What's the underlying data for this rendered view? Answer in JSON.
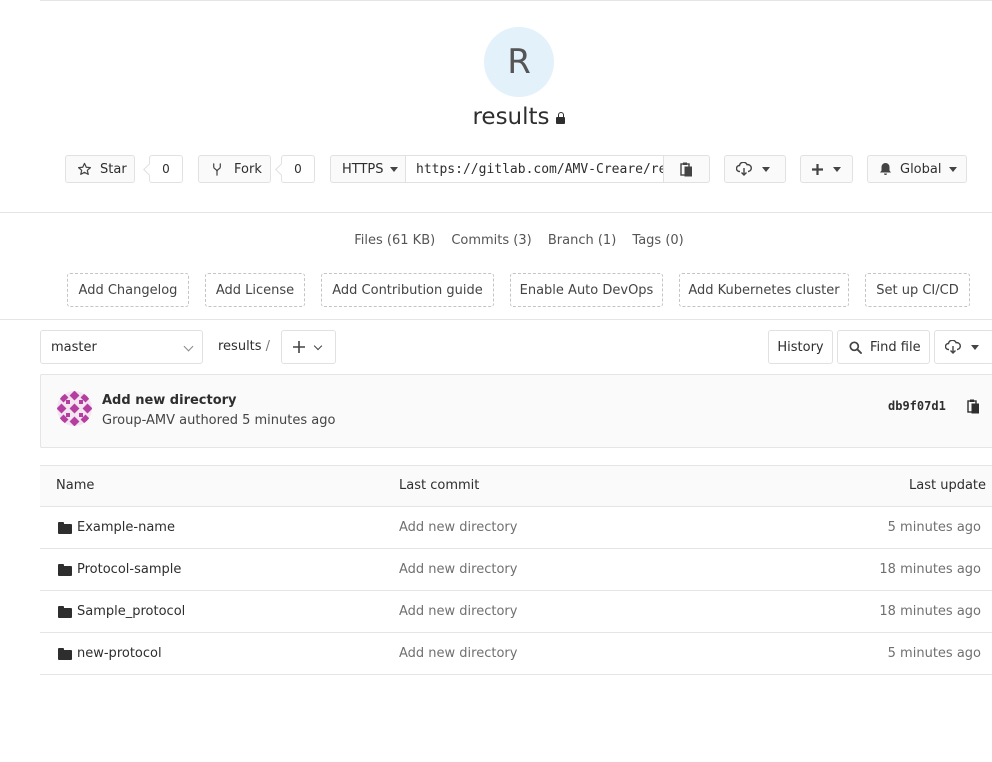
{
  "project": {
    "avatar_letter": "R",
    "name": "results"
  },
  "actions": {
    "star_label": "Star",
    "star_count": "0",
    "fork_label": "Fork",
    "fork_count": "0",
    "protocol": "HTTPS",
    "clone_url": "https://gitlab.com/AMV-Creare/results.git",
    "notification_label": "Global"
  },
  "stats": {
    "files": "Files (61 KB)",
    "commits": "Commits (3)",
    "branch": "Branch (1)",
    "tags": "Tags (0)"
  },
  "suggestions": [
    "Add Changelog",
    "Add License",
    "Add Contribution guide",
    "Enable Auto DevOps",
    "Add Kubernetes cluster",
    "Set up CI/CD"
  ],
  "tree": {
    "branch": "master",
    "path": "results",
    "separator": "/",
    "history_label": "History",
    "find_file_label": "Find file"
  },
  "last_commit": {
    "title": "Add new directory",
    "author": "Group-AMV",
    "authored_text": "authored 5 minutes ago",
    "sha": "db9f07d1"
  },
  "table": {
    "headers": {
      "name": "Name",
      "last_commit": "Last commit",
      "last_update": "Last update"
    },
    "rows": [
      {
        "name": "Example-name",
        "commit": "Add new directory",
        "updated": "5 minutes ago"
      },
      {
        "name": "Protocol-sample",
        "commit": "Add new directory",
        "updated": "18 minutes ago"
      },
      {
        "name": "Sample_protocol",
        "commit": "Add new directory",
        "updated": "18 minutes ago"
      },
      {
        "name": "new-protocol",
        "commit": "Add new directory",
        "updated": "5 minutes ago"
      }
    ]
  },
  "colors": {
    "avatar_bg": "#e3f1fb",
    "identicon": "#b53fa1"
  }
}
